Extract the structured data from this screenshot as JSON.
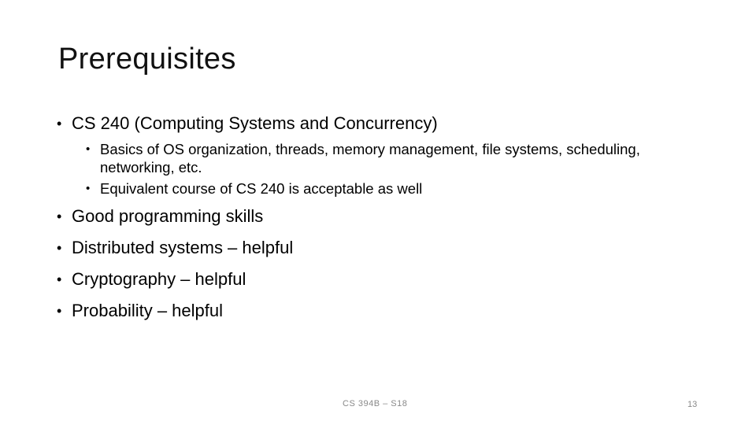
{
  "slide": {
    "title": "Prerequisites",
    "bullets": [
      {
        "text": "CS 240 (Computing Systems and Concurrency)",
        "sub": [
          "Basics of OS organization, threads, memory management, file systems, scheduling, networking, etc.",
          "Equivalent course of CS 240 is acceptable as well"
        ]
      },
      {
        "text": "Good programming skills"
      },
      {
        "text": "Distributed systems – helpful"
      },
      {
        "text": "Cryptography – helpful"
      },
      {
        "text": "Probability – helpful"
      }
    ],
    "footer": "CS 394B – S18",
    "page_number": "13"
  }
}
